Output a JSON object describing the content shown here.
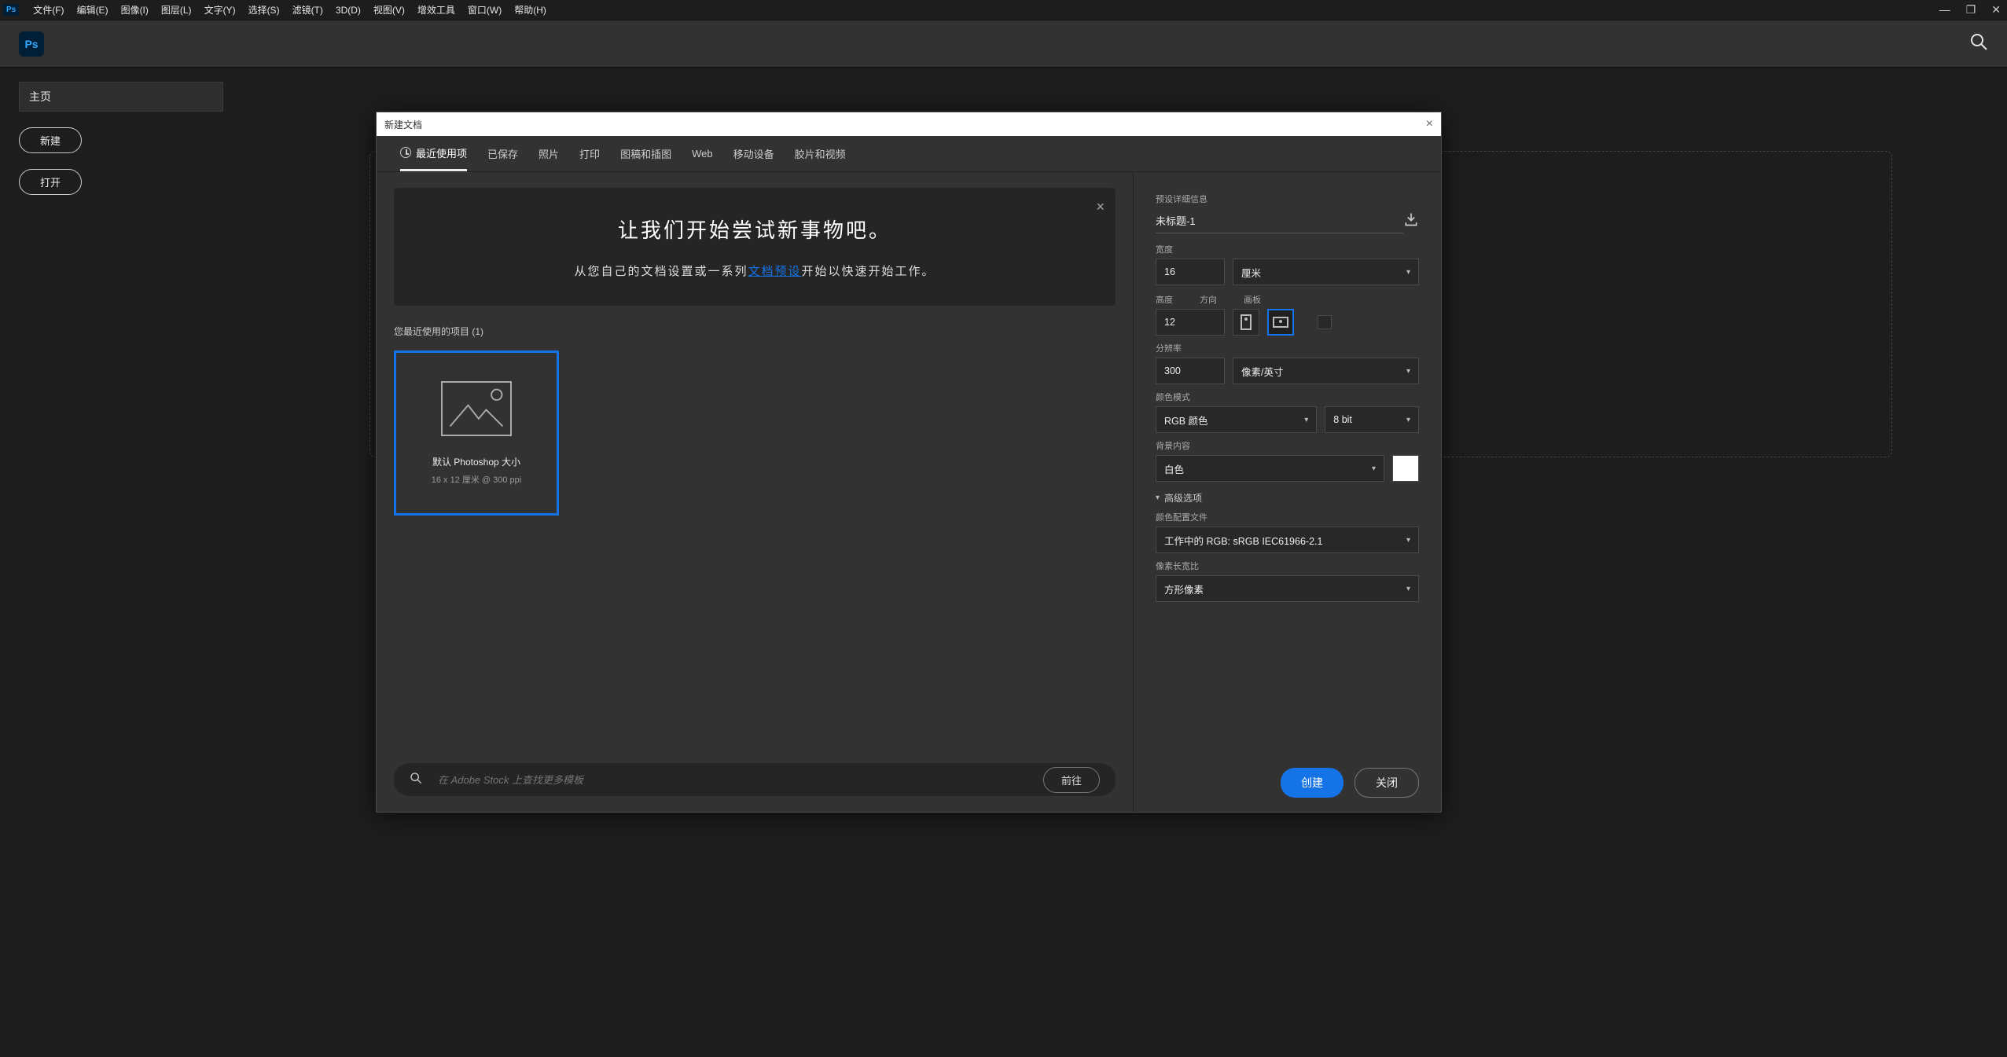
{
  "app": {
    "badge": "Ps"
  },
  "menu": {
    "items": [
      "文件(F)",
      "编辑(E)",
      "图像(I)",
      "图层(L)",
      "文字(Y)",
      "选择(S)",
      "滤镜(T)",
      "3D(D)",
      "视图(V)",
      "增效工具",
      "窗口(W)",
      "帮助(H)"
    ]
  },
  "home": {
    "tab": "主页",
    "new_btn": "新建",
    "open_btn": "打开"
  },
  "dialog": {
    "title": "新建文档",
    "tabs": [
      "最近使用项",
      "已保存",
      "照片",
      "打印",
      "图稿和插图",
      "Web",
      "移动设备",
      "胶片和视频"
    ],
    "active_tab_index": 0,
    "hero": {
      "title": "让我们开始尝试新事物吧。",
      "text_before": "从您自己的文档设置或一系列",
      "link": "文档预设",
      "text_after": "开始以快速开始工作。"
    },
    "recent_label": "您最近使用的项目 (1)",
    "preset": {
      "title": "默认 Photoshop 大小",
      "subtitle": "16 x 12 厘米 @ 300 ppi"
    },
    "stock": {
      "placeholder": "在 Adobe Stock 上查找更多模板",
      "go": "前往"
    },
    "panel": {
      "section": "预设详细信息",
      "name": "未标题-1",
      "width_label": "宽度",
      "width_value": "16",
      "unit": "厘米",
      "height_label": "高度",
      "height_value": "12",
      "orientation_label": "方向",
      "artboards_label": "画板",
      "resolution_label": "分辨率",
      "resolution_value": "300",
      "resolution_unit": "像素/英寸",
      "color_mode_label": "颜色模式",
      "color_mode_value": "RGB 颜色",
      "bit_depth": "8 bit",
      "bg_label": "背景内容",
      "bg_value": "白色",
      "adv_label": "高级选项",
      "profile_label": "颜色配置文件",
      "profile_value": "工作中的 RGB: sRGB IEC61966-2.1",
      "par_label": "像素长宽比",
      "par_value": "方形像素"
    },
    "create": "创建",
    "close": "关闭"
  }
}
